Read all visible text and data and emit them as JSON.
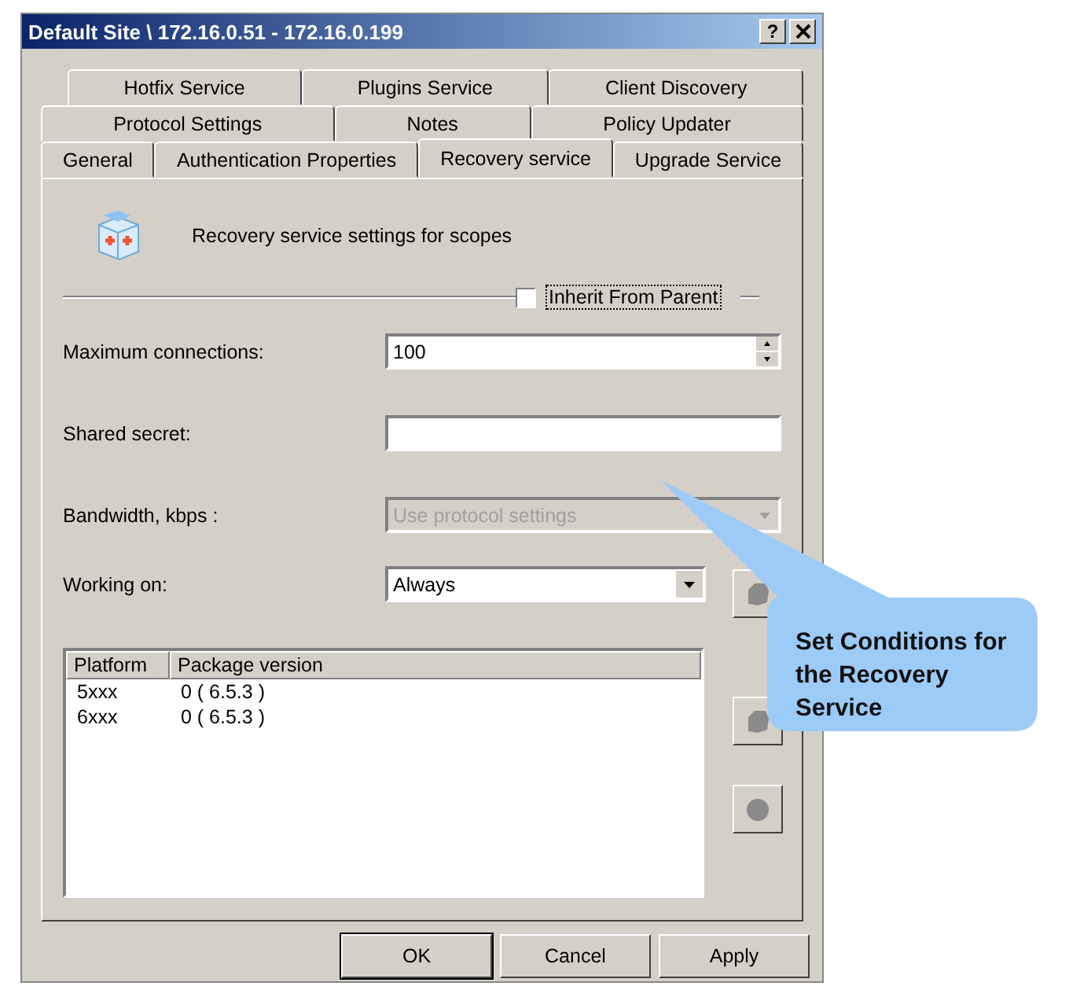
{
  "window": {
    "title": "Default Site \\ 172.16.0.51 - 172.16.0.199",
    "help": "?"
  },
  "tab_rows": [
    [
      {
        "label": "Hotfix Service",
        "selected": false
      },
      {
        "label": "Plugins Service",
        "selected": false
      },
      {
        "label": "Client Discovery",
        "selected": false
      }
    ],
    [
      {
        "label": "Protocol Settings",
        "selected": false
      },
      {
        "label": "Notes",
        "selected": false
      },
      {
        "label": "Policy Updater",
        "selected": false
      }
    ],
    [
      {
        "label": "General",
        "selected": false
      },
      {
        "label": "Authentication Properties",
        "selected": false
      },
      {
        "label": "Recovery service",
        "selected": true
      },
      {
        "label": "Upgrade Service",
        "selected": false
      }
    ]
  ],
  "header": {
    "text": "Recovery service settings for scopes"
  },
  "inherit": {
    "label": "Inherit From Parent",
    "checked": false
  },
  "fields": [
    {
      "kind": "spin",
      "label": "Maximum connections:",
      "value": "100",
      "disabled": false
    },
    {
      "kind": "text",
      "label": "Shared secret:",
      "disabled": false
    },
    {
      "kind": "combo",
      "label": "Bandwidth, kbps :",
      "value": "Use protocol settings",
      "disabled": true
    }
  ],
  "working_on": {
    "label": "Working on:",
    "value": "Always"
  },
  "list": {
    "columns": [
      "Platform",
      "Package version"
    ],
    "rows": [
      [
        "5xxx",
        "0 ( 6.5.3 )"
      ],
      [
        "6xxx",
        "0 ( 6.5.3 )"
      ]
    ]
  },
  "buttons": [
    {
      "label": "OK",
      "default": true
    },
    {
      "label": "Cancel",
      "default": false
    },
    {
      "label": "Apply",
      "default": false
    }
  ],
  "callout": {
    "text": "Set Conditions for the Recovery Service"
  }
}
